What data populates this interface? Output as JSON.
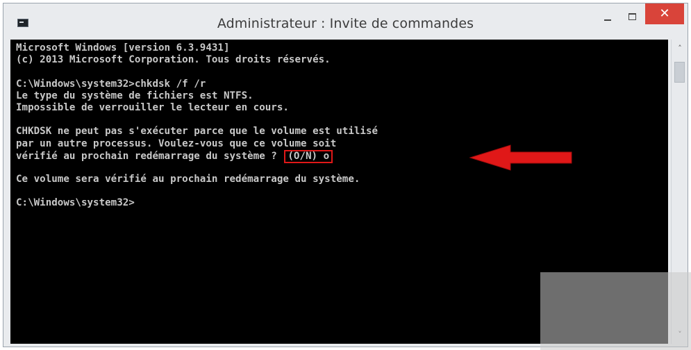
{
  "window": {
    "title": "Administrateur : Invite de commandes",
    "app_icon": "console-icon",
    "buttons": {
      "minimize": "minimize-icon",
      "maximize": "maximize-icon",
      "close_label": "✕"
    }
  },
  "console": {
    "lines": [
      "Microsoft Windows [version 6.3.9431]",
      "(c) 2013 Microsoft Corporation. Tous droits réservés.",
      "",
      "C:\\Windows\\system32>chkdsk /f /r",
      "Le type du système de fichiers est NTFS.",
      "Impossible de verrouiller le lecteur en cours.",
      "",
      "CHKDSK ne peut pas s'exécuter parce que le volume est utilisé",
      "par un autre processus. Voulez-vous que ce volume soit",
      "vérifié au prochain redémarrage du système ?",
      "",
      "Ce volume sera vérifié au prochain redémarrage du système.",
      "",
      "C:\\Windows\\system32>"
    ],
    "prompt_answer": "(O/N) o",
    "text_color": "#c8c8c8",
    "background_color": "#000000"
  },
  "annotation": {
    "highlight_color": "#e01818",
    "arrow_color": "#e01818",
    "arrow_icon": "red-arrow-left-icon"
  },
  "scrollbar": {
    "up_label": "˄",
    "down_label": "˅"
  }
}
